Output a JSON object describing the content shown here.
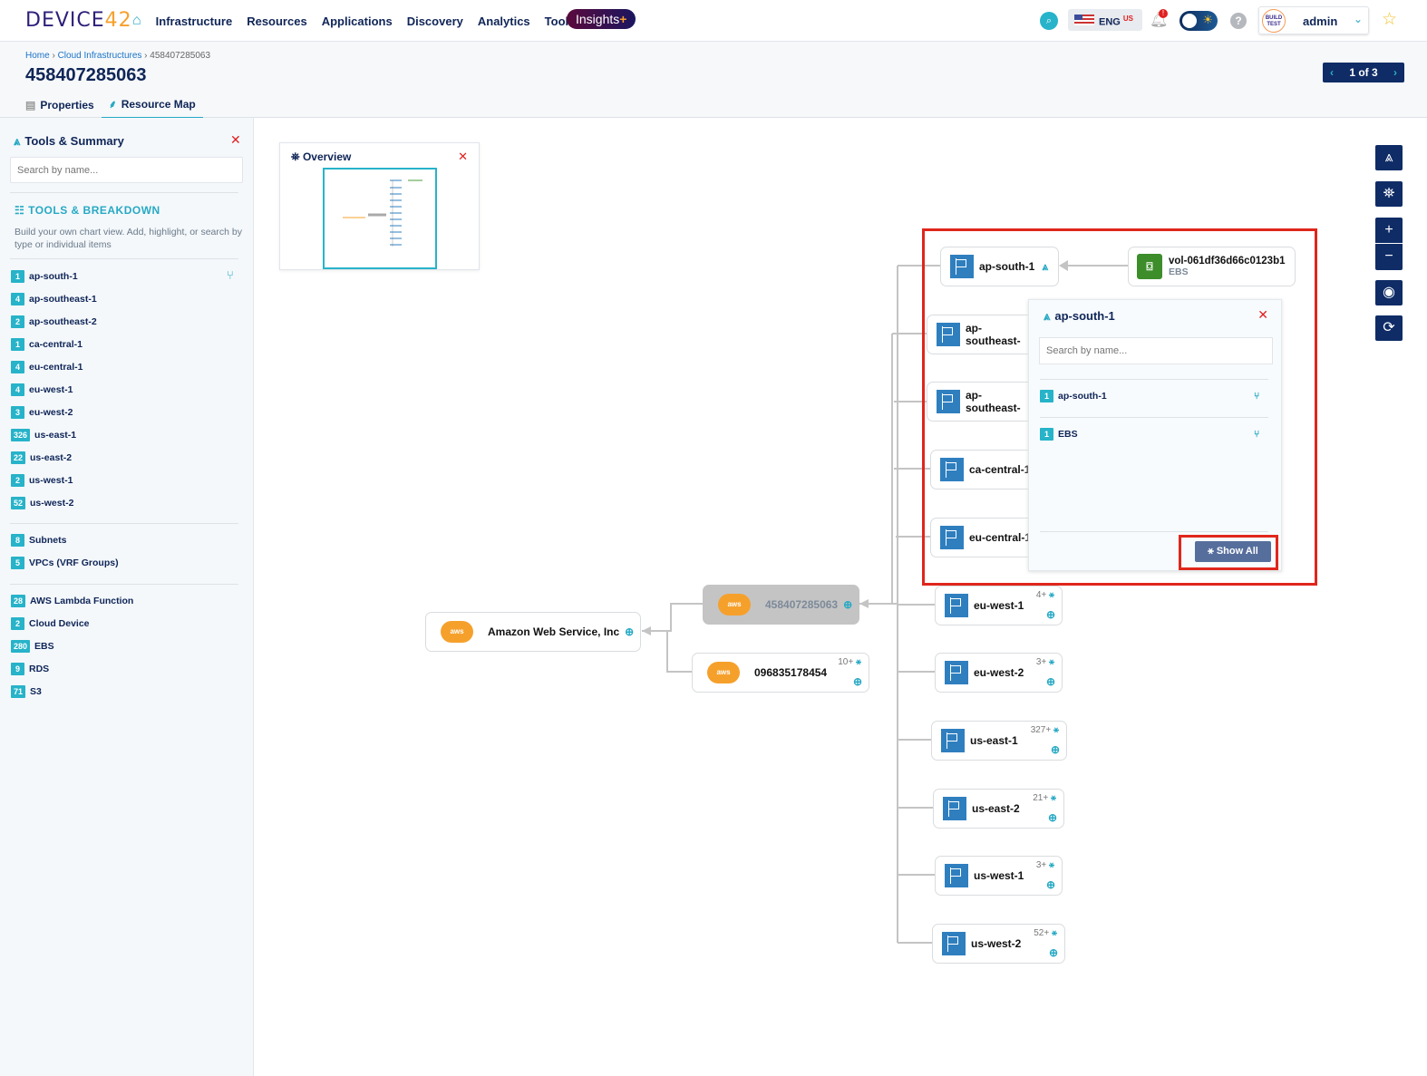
{
  "brand": {
    "logo_text": "DEVICE",
    "logo_accent": "42"
  },
  "nav": {
    "items": [
      "Infrastructure",
      "Resources",
      "Applications",
      "Discovery",
      "Analytics",
      "Tools"
    ],
    "insights": "Insights",
    "insights_plus": "+"
  },
  "topright": {
    "lang": "ENG",
    "region": "US",
    "notification": "!",
    "user": "admin",
    "avatar_line1": "BUILD",
    "avatar_line2": "TEST"
  },
  "header": {
    "breadcrumb": [
      "Home",
      "Cloud Infrastructures",
      "458407285063"
    ],
    "title": "458407285063",
    "tabs": [
      "Properties",
      "Resource Map"
    ],
    "pager": "1 of 3"
  },
  "sidebar": {
    "title": "Tools & Summary",
    "search_placeholder": "Search by name...",
    "section": "TOOLS & BREAKDOWN",
    "description": "Build your own chart view. Add, highlight, or search by type or individual items",
    "regions": [
      {
        "c": "1",
        "n": "ap-south-1"
      },
      {
        "c": "4",
        "n": "ap-southeast-1"
      },
      {
        "c": "2",
        "n": "ap-southeast-2"
      },
      {
        "c": "1",
        "n": "ca-central-1"
      },
      {
        "c": "4",
        "n": "eu-central-1"
      },
      {
        "c": "4",
        "n": "eu-west-1"
      },
      {
        "c": "3",
        "n": "eu-west-2"
      },
      {
        "c": "326",
        "n": "us-east-1"
      },
      {
        "c": "22",
        "n": "us-east-2"
      },
      {
        "c": "2",
        "n": "us-west-1"
      },
      {
        "c": "52",
        "n": "us-west-2"
      }
    ],
    "network": [
      {
        "c": "8",
        "n": "Subnets"
      },
      {
        "c": "5",
        "n": "VPCs (VRF Groups)"
      }
    ],
    "types": [
      {
        "c": "28",
        "n": "AWS Lambda Function"
      },
      {
        "c": "2",
        "n": "Cloud Device"
      },
      {
        "c": "280",
        "n": "EBS"
      },
      {
        "c": "9",
        "n": "RDS"
      },
      {
        "c": "71",
        "n": "S3"
      }
    ]
  },
  "overview": {
    "title": "Overview"
  },
  "map": {
    "root": "Amazon Web Service, Inc",
    "aws_label": "aws",
    "account_selected": "458407285063",
    "account_other": {
      "name": "096835178454",
      "badge": "10+"
    },
    "regions": [
      {
        "name": "ap-south-1"
      },
      {
        "name": "ap-southeast-"
      },
      {
        "name": "ap-southeast-"
      },
      {
        "name": "ca-central-1"
      },
      {
        "name": "eu-central-1"
      },
      {
        "name": "eu-west-1",
        "badge": "4+"
      },
      {
        "name": "eu-west-2",
        "badge": "3+"
      },
      {
        "name": "us-east-1",
        "badge": "327+"
      },
      {
        "name": "us-east-2",
        "badge": "21+"
      },
      {
        "name": "us-west-1",
        "badge": "3+"
      },
      {
        "name": "us-west-2",
        "badge": "52+"
      }
    ],
    "volume": {
      "name": "vol-061df36d66c0123b1",
      "type": "EBS"
    }
  },
  "popup": {
    "title": "ap-south-1",
    "search_placeholder": "Search by name...",
    "items": [
      {
        "c": "1",
        "n": "ap-south-1"
      },
      {
        "c": "1",
        "n": "EBS"
      }
    ],
    "show_all": "Show All"
  },
  "colors": {
    "accent": "#27a9c4",
    "navy": "#0f2c66",
    "highlight": "#e0261c",
    "aws": "#f6a02c"
  }
}
